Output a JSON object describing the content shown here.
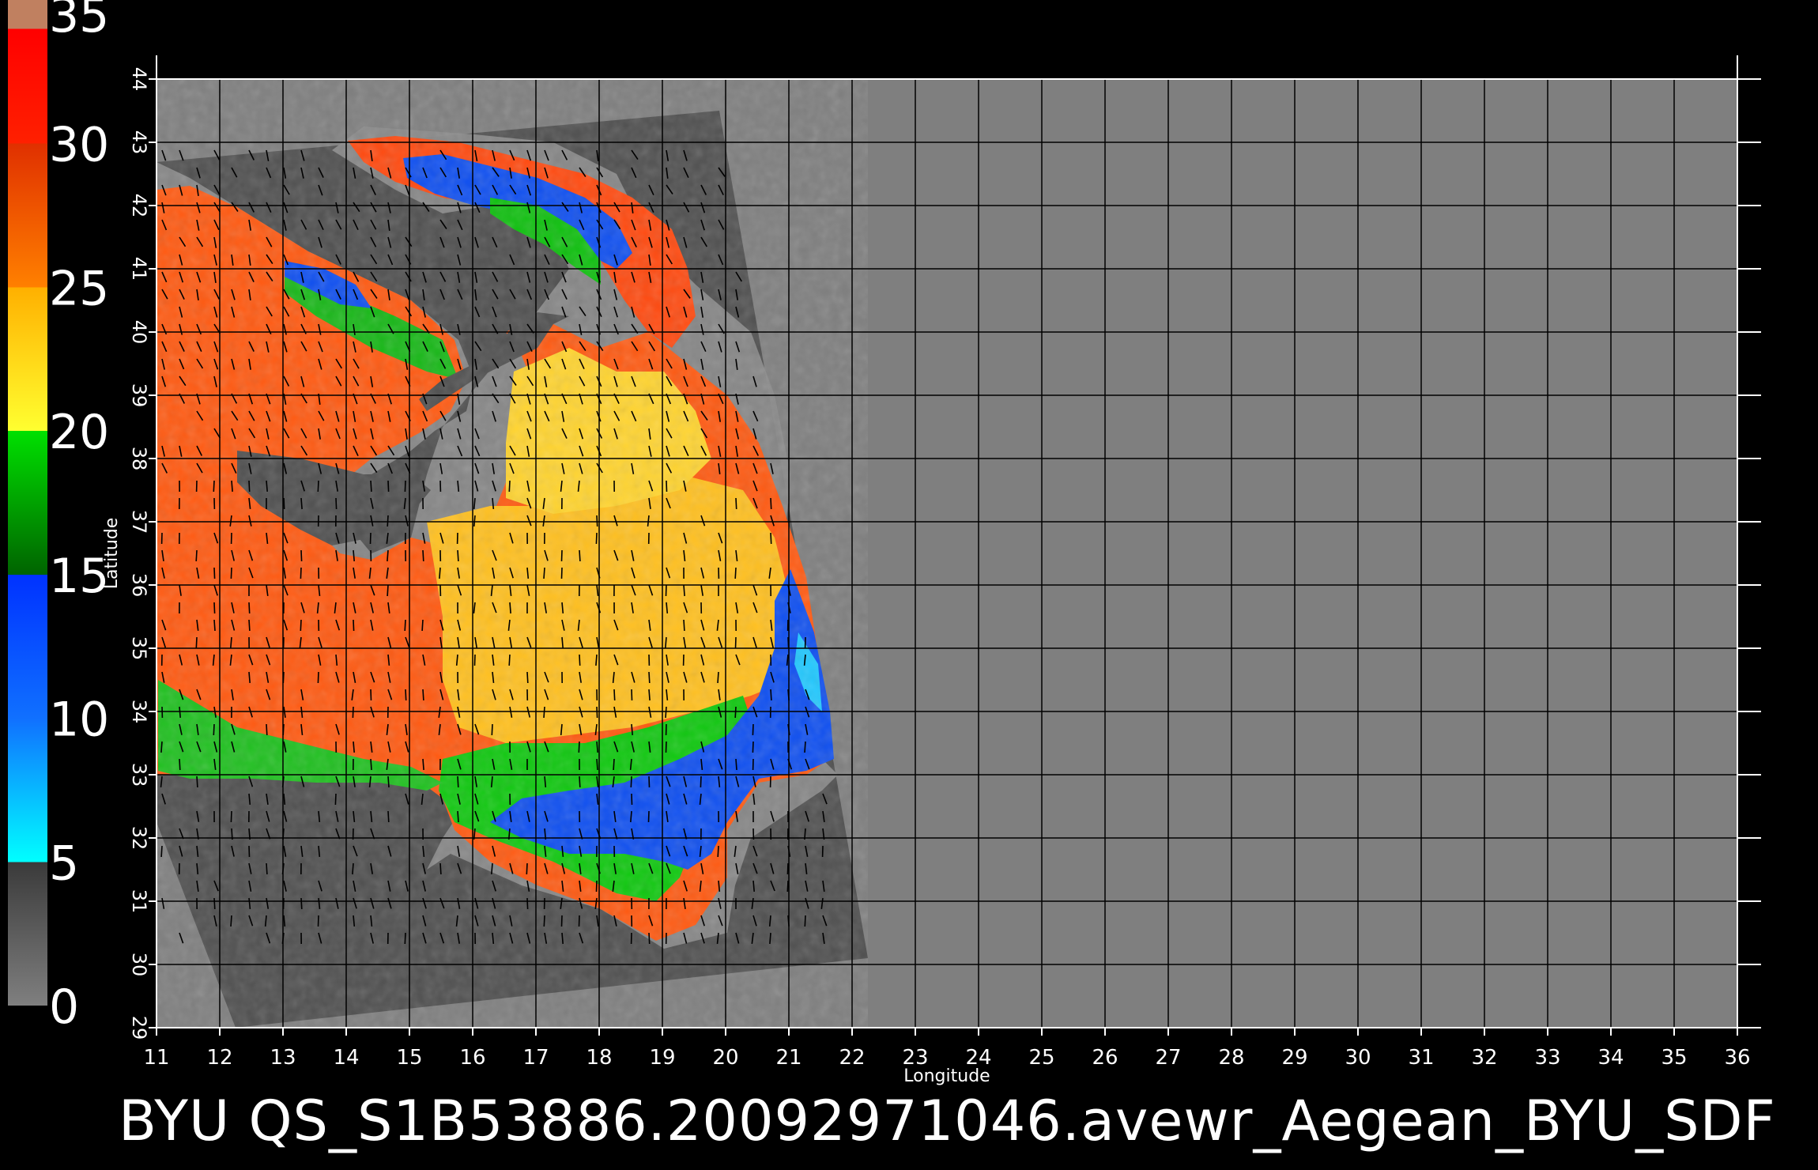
{
  "chart_data": {
    "type": "heatmap",
    "title": "",
    "xlabel": "Longitude",
    "ylabel": "Latitude",
    "xlim": [
      11,
      36
    ],
    "ylim": [
      29,
      44
    ],
    "x_ticks": [
      "11",
      "12",
      "13",
      "14",
      "15",
      "16",
      "17",
      "18",
      "19",
      "20",
      "21",
      "22",
      "23",
      "24",
      "25",
      "26",
      "27",
      "28",
      "29",
      "30",
      "31",
      "32",
      "33",
      "34",
      "35",
      "36"
    ],
    "y_ticks": [
      "29",
      "30",
      "31",
      "32",
      "33",
      "34",
      "35",
      "36",
      "37",
      "38",
      "39",
      "40",
      "41",
      "42",
      "43",
      "44"
    ],
    "grid": true,
    "colorbar": {
      "placement": "left",
      "range": [
        0,
        35
      ],
      "tick_labels": [
        "0",
        "5",
        "10",
        "15",
        "20",
        "25",
        "30",
        "35"
      ],
      "stops": [
        {
          "value": 0,
          "color": "#7f7f7f"
        },
        {
          "value": 5,
          "color": "#3a3a3a"
        },
        {
          "value": 5,
          "color": "#00ffff"
        },
        {
          "value": 10,
          "color": "#1070ff"
        },
        {
          "value": 15,
          "color": "#0032ff"
        },
        {
          "value": 15,
          "color": "#006400"
        },
        {
          "value": 20,
          "color": "#00e000"
        },
        {
          "value": 20,
          "color": "#ffff30"
        },
        {
          "value": 25,
          "color": "#ffb000"
        },
        {
          "value": 25,
          "color": "#ff8000"
        },
        {
          "value": 30,
          "color": "#e03000"
        },
        {
          "value": 30,
          "color": "#ff2000"
        },
        {
          "value": 34,
          "color": "#ff0000"
        },
        {
          "value": 34,
          "color": "#c08060"
        },
        {
          "value": 35,
          "color": "#c08060"
        }
      ]
    },
    "colors": {
      "background": "#000000",
      "no_data": "#7f7f7f",
      "land": "#505050",
      "coast": "#8a8a8a",
      "grid": "#000000",
      "wind_vectors": "#000000"
    }
  },
  "caption": "BYU  QS_S1B53886.20092971046.avewr_Aegean_BYU_SDF"
}
